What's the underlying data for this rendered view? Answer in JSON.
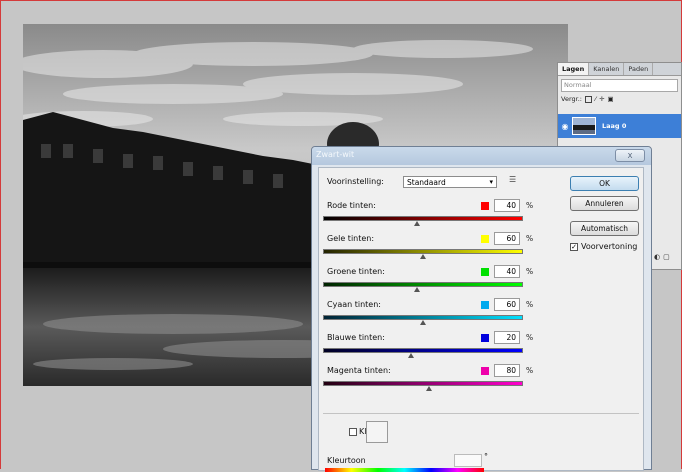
{
  "layers_panel": {
    "tabs": [
      "Lagen",
      "Kanalen",
      "Paden"
    ],
    "blend_mode": "Normaal",
    "lock_label": "Vergr.:",
    "layer_name": "Laag 0"
  },
  "dialog": {
    "title": "Zwart-wit",
    "close_label": "X",
    "preset_label": "Voorinstelling:",
    "preset_value": "Standaard",
    "buttons": {
      "ok": "OK",
      "cancel": "Annuleren",
      "auto": "Automatisch"
    },
    "preview_label": "Voorvertoning",
    "preview_checked": true,
    "sliders": [
      {
        "label": "Rode tinten:",
        "value": "40",
        "unit": "%",
        "swatch": "#ff0000",
        "gradient": [
          "#000000",
          "#ff0000"
        ],
        "position": 0.47
      },
      {
        "label": "Gele tinten:",
        "value": "60",
        "unit": "%",
        "swatch": "#ffff00",
        "gradient": [
          "#222200",
          "#ffff00"
        ],
        "position": 0.5
      },
      {
        "label": "Groene tinten:",
        "value": "40",
        "unit": "%",
        "swatch": "#00e000",
        "gradient": [
          "#002200",
          "#00ff00"
        ],
        "position": 0.47
      },
      {
        "label": "Cyaan tinten:",
        "value": "60",
        "unit": "%",
        "swatch": "#00aaee",
        "gradient": [
          "#002233",
          "#00e0ff"
        ],
        "position": 0.5
      },
      {
        "label": "Blauwe tinten:",
        "value": "20",
        "unit": "%",
        "swatch": "#0000dd",
        "gradient": [
          "#000022",
          "#0000ff"
        ],
        "position": 0.44
      },
      {
        "label": "Magenta tinten:",
        "value": "80",
        "unit": "%",
        "swatch": "#ee00aa",
        "gradient": [
          "#220011",
          "#ff00cc"
        ],
        "position": 0.53
      }
    ],
    "tint_label": "Kleur",
    "hue_label": "Kleurtoon",
    "hue_degree": "°"
  }
}
